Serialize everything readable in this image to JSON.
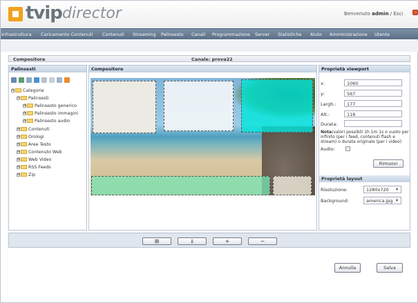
{
  "header": {
    "brand": "tvip",
    "product": "director",
    "welcome": "Benvenuto",
    "user": "admin",
    "separator": "/",
    "logout": "Esci"
  },
  "menu": [
    "Infrastruttura",
    "Caricamento Contenuti",
    "Contenuti",
    "Streaming",
    "Palinsesto",
    "Canali",
    "Programmazione",
    "Server",
    "Statistiche",
    "Aiuto",
    "Amministrazione",
    "Utente"
  ],
  "compositor_bar": {
    "title": "Compositore",
    "channel": "Canale: prova22"
  },
  "left": {
    "title": "Palinsesti",
    "tree": [
      {
        "label": "Categorie",
        "level": 0,
        "expander": "⊟"
      },
      {
        "label": "Palinsesti",
        "level": 1,
        "expander": "⊟"
      },
      {
        "label": "Palinsesto generico",
        "level": 2,
        "expander": "⊞"
      },
      {
        "label": "Palinsesto immagini",
        "level": 2,
        "expander": "⊞"
      },
      {
        "label": "Palinsesto audio",
        "level": 2,
        "expander": "⊞"
      },
      {
        "label": "Contenuti",
        "level": 1,
        "expander": "⊞"
      },
      {
        "label": "Orologi",
        "level": 1,
        "expander": "⊞"
      },
      {
        "label": "Aree Testo",
        "level": 1,
        "expander": "⊞"
      },
      {
        "label": "Contenuto Web",
        "level": 1,
        "expander": "⊞"
      },
      {
        "label": "Web Video",
        "level": 1,
        "expander": "⊞"
      },
      {
        "label": "RSS Feeds",
        "level": 1,
        "expander": "⊞"
      },
      {
        "label": "Zip",
        "level": 1,
        "expander": "⊞"
      }
    ]
  },
  "center": {
    "title": "Compositore"
  },
  "viewport": {
    "title": "Proprietà viewport",
    "x_label": "x:",
    "x": "1060",
    "y_label": "y:",
    "y": "567",
    "width_label": "Largh.:",
    "width": "177",
    "height_label": "Alt.:",
    "height": "116",
    "duration_label": "Durata:",
    "duration": "",
    "note_label": "Nota:",
    "note": "valori possibili 1h 1m 1s o vuoto per infinito (per i feed, contenuti flash e stream) o durata originale (per i video)",
    "audio_label": "Audio:",
    "remove": "Rimuovi"
  },
  "layout": {
    "title": "Proprietà layout",
    "resolution_label": "Risoluzione:",
    "resolution": "1280x720",
    "background_label": "Background:",
    "background": "america.jpg"
  },
  "toolbar_buttons": [
    "⊞",
    "⫫",
    "+",
    "−"
  ],
  "actions": {
    "cancel": "Annulla",
    "save": "Salva"
  }
}
